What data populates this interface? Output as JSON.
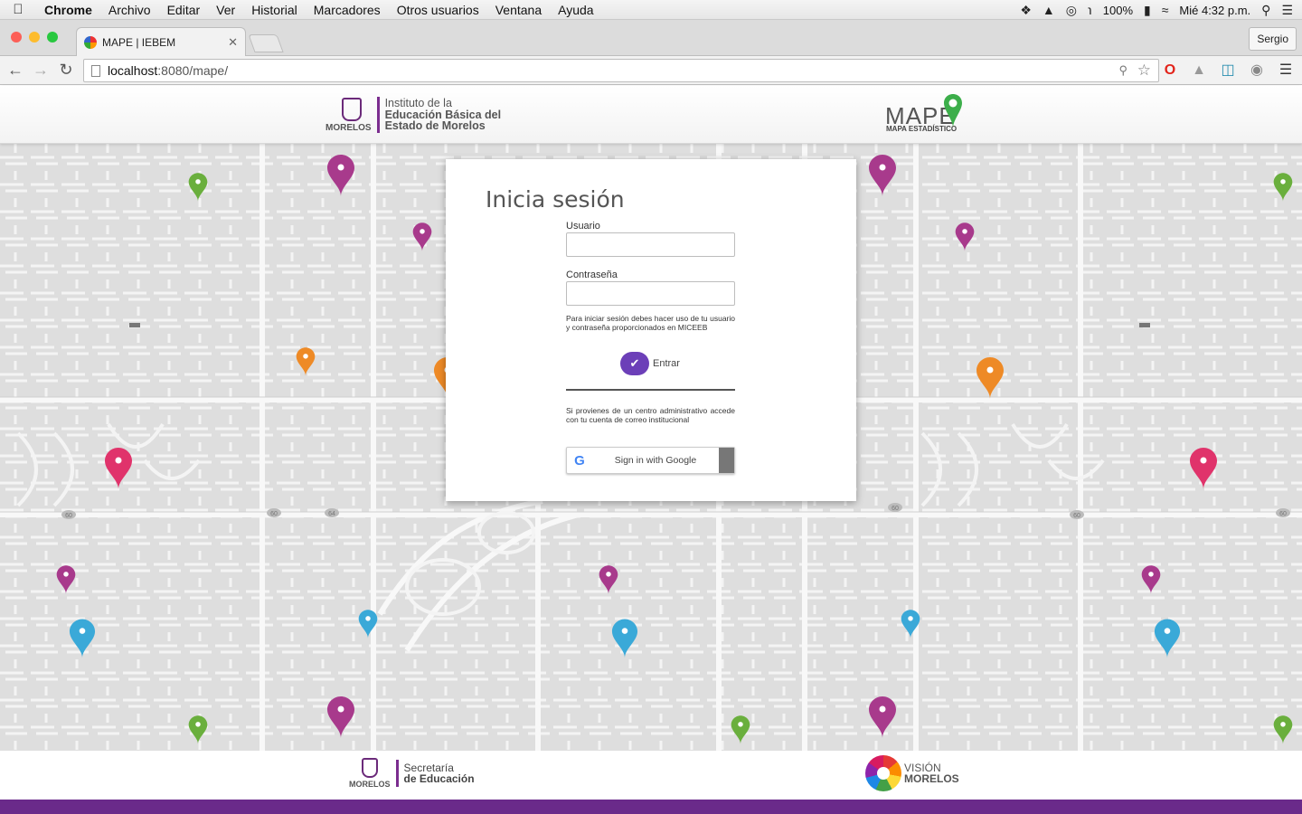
{
  "menubar": {
    "app": "Chrome",
    "items": [
      "Archivo",
      "Editar",
      "Ver",
      "Historial",
      "Marcadores",
      "Otros usuarios",
      "Ventana",
      "Ayuda"
    ],
    "battery": "100%",
    "clock": "Mié 4:32 p.m."
  },
  "browser": {
    "tab_title": "MAPE | IEBEM",
    "profile_name": "Sergio",
    "url_host": "localhost",
    "url_path": ":8080/mape/"
  },
  "header": {
    "left_logo": {
      "morelos": "MORELOS",
      "line1": "Instituto de la",
      "line2": "Educación Básica del",
      "line3": "Estado de Morelos"
    },
    "right_logo": {
      "word": "MAPE",
      "sub": "MAPA ESTADÍSTICO"
    }
  },
  "login": {
    "title": "Inicia sesión",
    "user_label": "Usuario",
    "user_value": "",
    "password_label": "Contraseña",
    "password_value": "",
    "info_text": "Para iniciar sesión debes hacer uso de tu usuario y contraseña proporcionados en MICEEB",
    "submit_label": "Entrar",
    "institutional_text": "Si provienes de un centro administrativo accede con tu cuenta de correo institucional",
    "google_label": "Sign in with Google"
  },
  "footer": {
    "left_logo": {
      "morelos": "MORELOS",
      "line1": "Secretaría",
      "line2": "de Educación"
    },
    "right_logo": {
      "line1": "VISIÓN",
      "line2": "MORELOS"
    }
  },
  "colors": {
    "pin_magenta": "#a83a8c",
    "pin_pink": "#e0336b",
    "pin_green": "#6aaf3d",
    "pin_orange": "#ee8a26",
    "pin_blue": "#3aa9d8",
    "brand_purple": "#6a2a8a",
    "entrar_button": "#6c3fb8"
  }
}
